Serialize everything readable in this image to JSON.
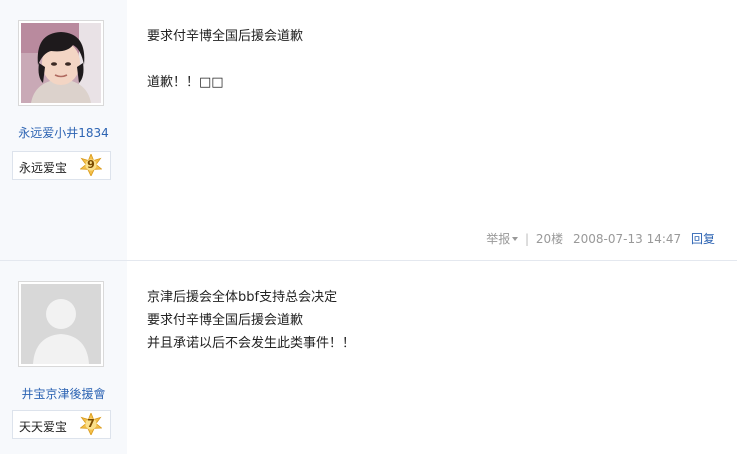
{
  "posts": [
    {
      "username": "永远爱小井1834",
      "level_name": "永远爱宝",
      "level_num": "9",
      "lines": [
        "要求付辛博全国后援会道歉",
        "",
        "道歉！！□□"
      ],
      "meta": {
        "report": "举报",
        "sep": "|",
        "floor": "20楼",
        "time": "2008-07-13 14:47",
        "reply": "回复"
      }
    },
    {
      "username": "井宝京津後援會",
      "level_name": "天天爱宝",
      "level_num": "7",
      "lines": [
        "京津后援会全体bbf支持总会决定",
        "要求付辛博全国后援会道歉",
        "并且承诺以后不会发生此类事件！！"
      ]
    }
  ],
  "colors": {
    "link": "#2d64b3",
    "sidebar_bg": "#f7f9fc",
    "meta": "#999999"
  },
  "icons": {
    "level_badge": "star-badge-icon",
    "report_caret": "caret-down-icon"
  }
}
